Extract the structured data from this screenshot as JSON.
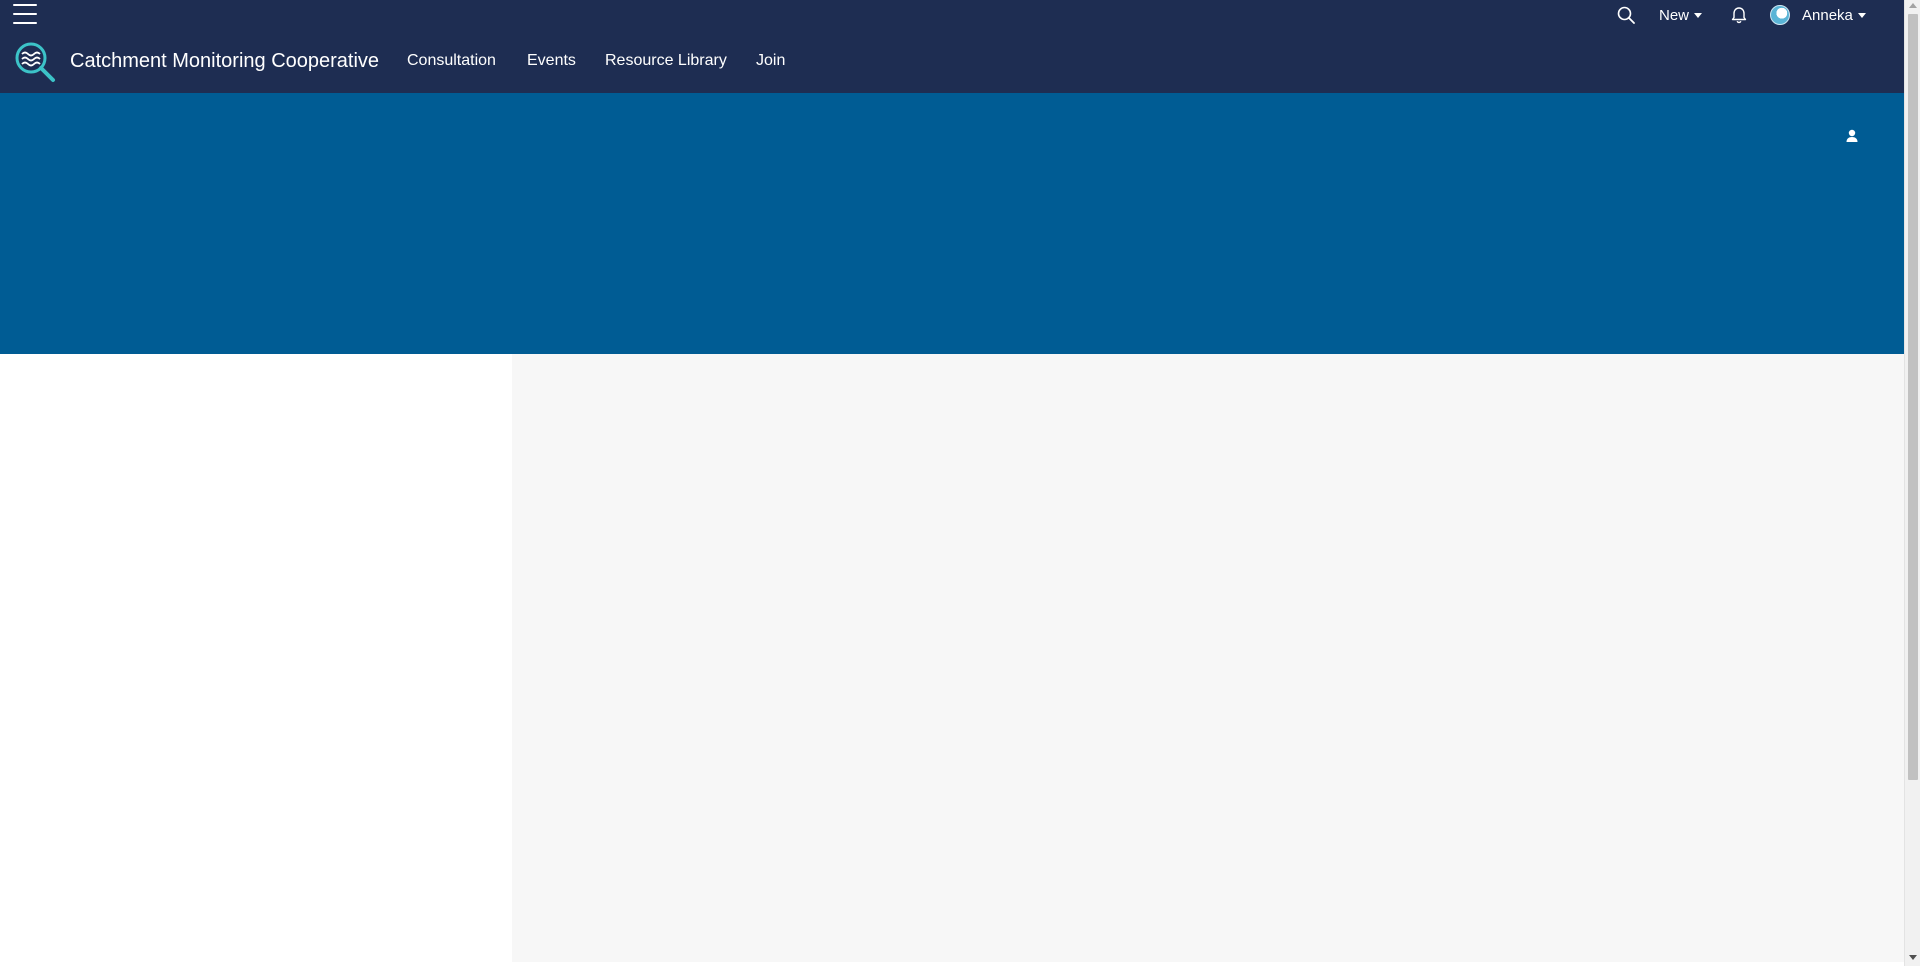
{
  "header": {
    "site_title": "Catchment Monitoring Cooperative",
    "nav": {
      "consultation": "Consultation",
      "events": "Events",
      "resource_library": "Resource Library",
      "join": "Join"
    },
    "utility": {
      "new_label": "New",
      "user_name": "Anneka"
    },
    "icons": {
      "menu": "hamburger-menu-icon",
      "logo": "magnifier-waves-logo",
      "search": "search-icon",
      "notifications": "bell-icon",
      "avatar": "avatar",
      "banner_user": "user-icon"
    }
  },
  "colors": {
    "topbar": "#1e2d52",
    "banner": "#005c94",
    "content_bg": "#f7f7f7",
    "logo_accent": "#3cc3c8"
  }
}
